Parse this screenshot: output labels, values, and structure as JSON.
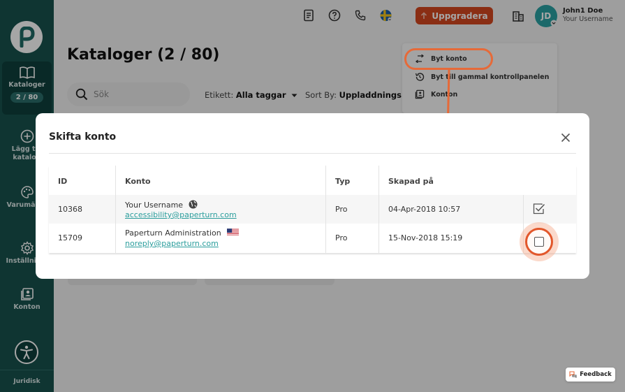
{
  "sidebar": {
    "items": [
      {
        "label": "Kataloger",
        "count": "2 / 80"
      },
      {
        "label": "Lägg till katalog"
      },
      {
        "label": "Varumärkesprofiler"
      },
      {
        "label": "Inställningar"
      },
      {
        "label": "Konton"
      }
    ],
    "footer_label": "Juridisk"
  },
  "header": {
    "upgrade_label": "Uppgradera",
    "user": {
      "initials": "JD",
      "name": "John1 Doe",
      "handle": "Your Username"
    }
  },
  "page": {
    "title": "Kataloger (2 / 80)",
    "search_placeholder": "Sök",
    "filter_tag": {
      "label": "Etikett:",
      "value": "Alla taggar"
    },
    "sort": {
      "label": "Sort By:",
      "value": "Uppladdningsdat"
    }
  },
  "dropdown": {
    "items": [
      {
        "label": "Byt konto",
        "icon": "swap-icon"
      },
      {
        "label": "Byt till gammal kontrollpanelen",
        "icon": "history-icon"
      },
      {
        "label": "Konton",
        "icon": "accounts-icon"
      }
    ]
  },
  "modal": {
    "title": "Skifta konto",
    "columns": [
      "ID",
      "Konto",
      "Typ",
      "Skapad på"
    ],
    "rows": [
      {
        "id": "10368",
        "name": "Your Username",
        "email": "accessibility@paperturn.com",
        "type": "Pro",
        "created": "04-Apr-2018 10:57",
        "selected": true,
        "flag": "globe-icon"
      },
      {
        "id": "15709",
        "name": "Paperturn Administration",
        "email": "noreply@paperturn.com",
        "type": "Pro",
        "created": "15-Nov-2018 15:19",
        "selected": false,
        "flag": "us-flag-icon"
      }
    ]
  },
  "feedback_label": "Feedback",
  "colors": {
    "sidebar": "#17524e",
    "accent": "#d4471f",
    "link": "#2a9d9c",
    "highlight": "#e66a39"
  }
}
